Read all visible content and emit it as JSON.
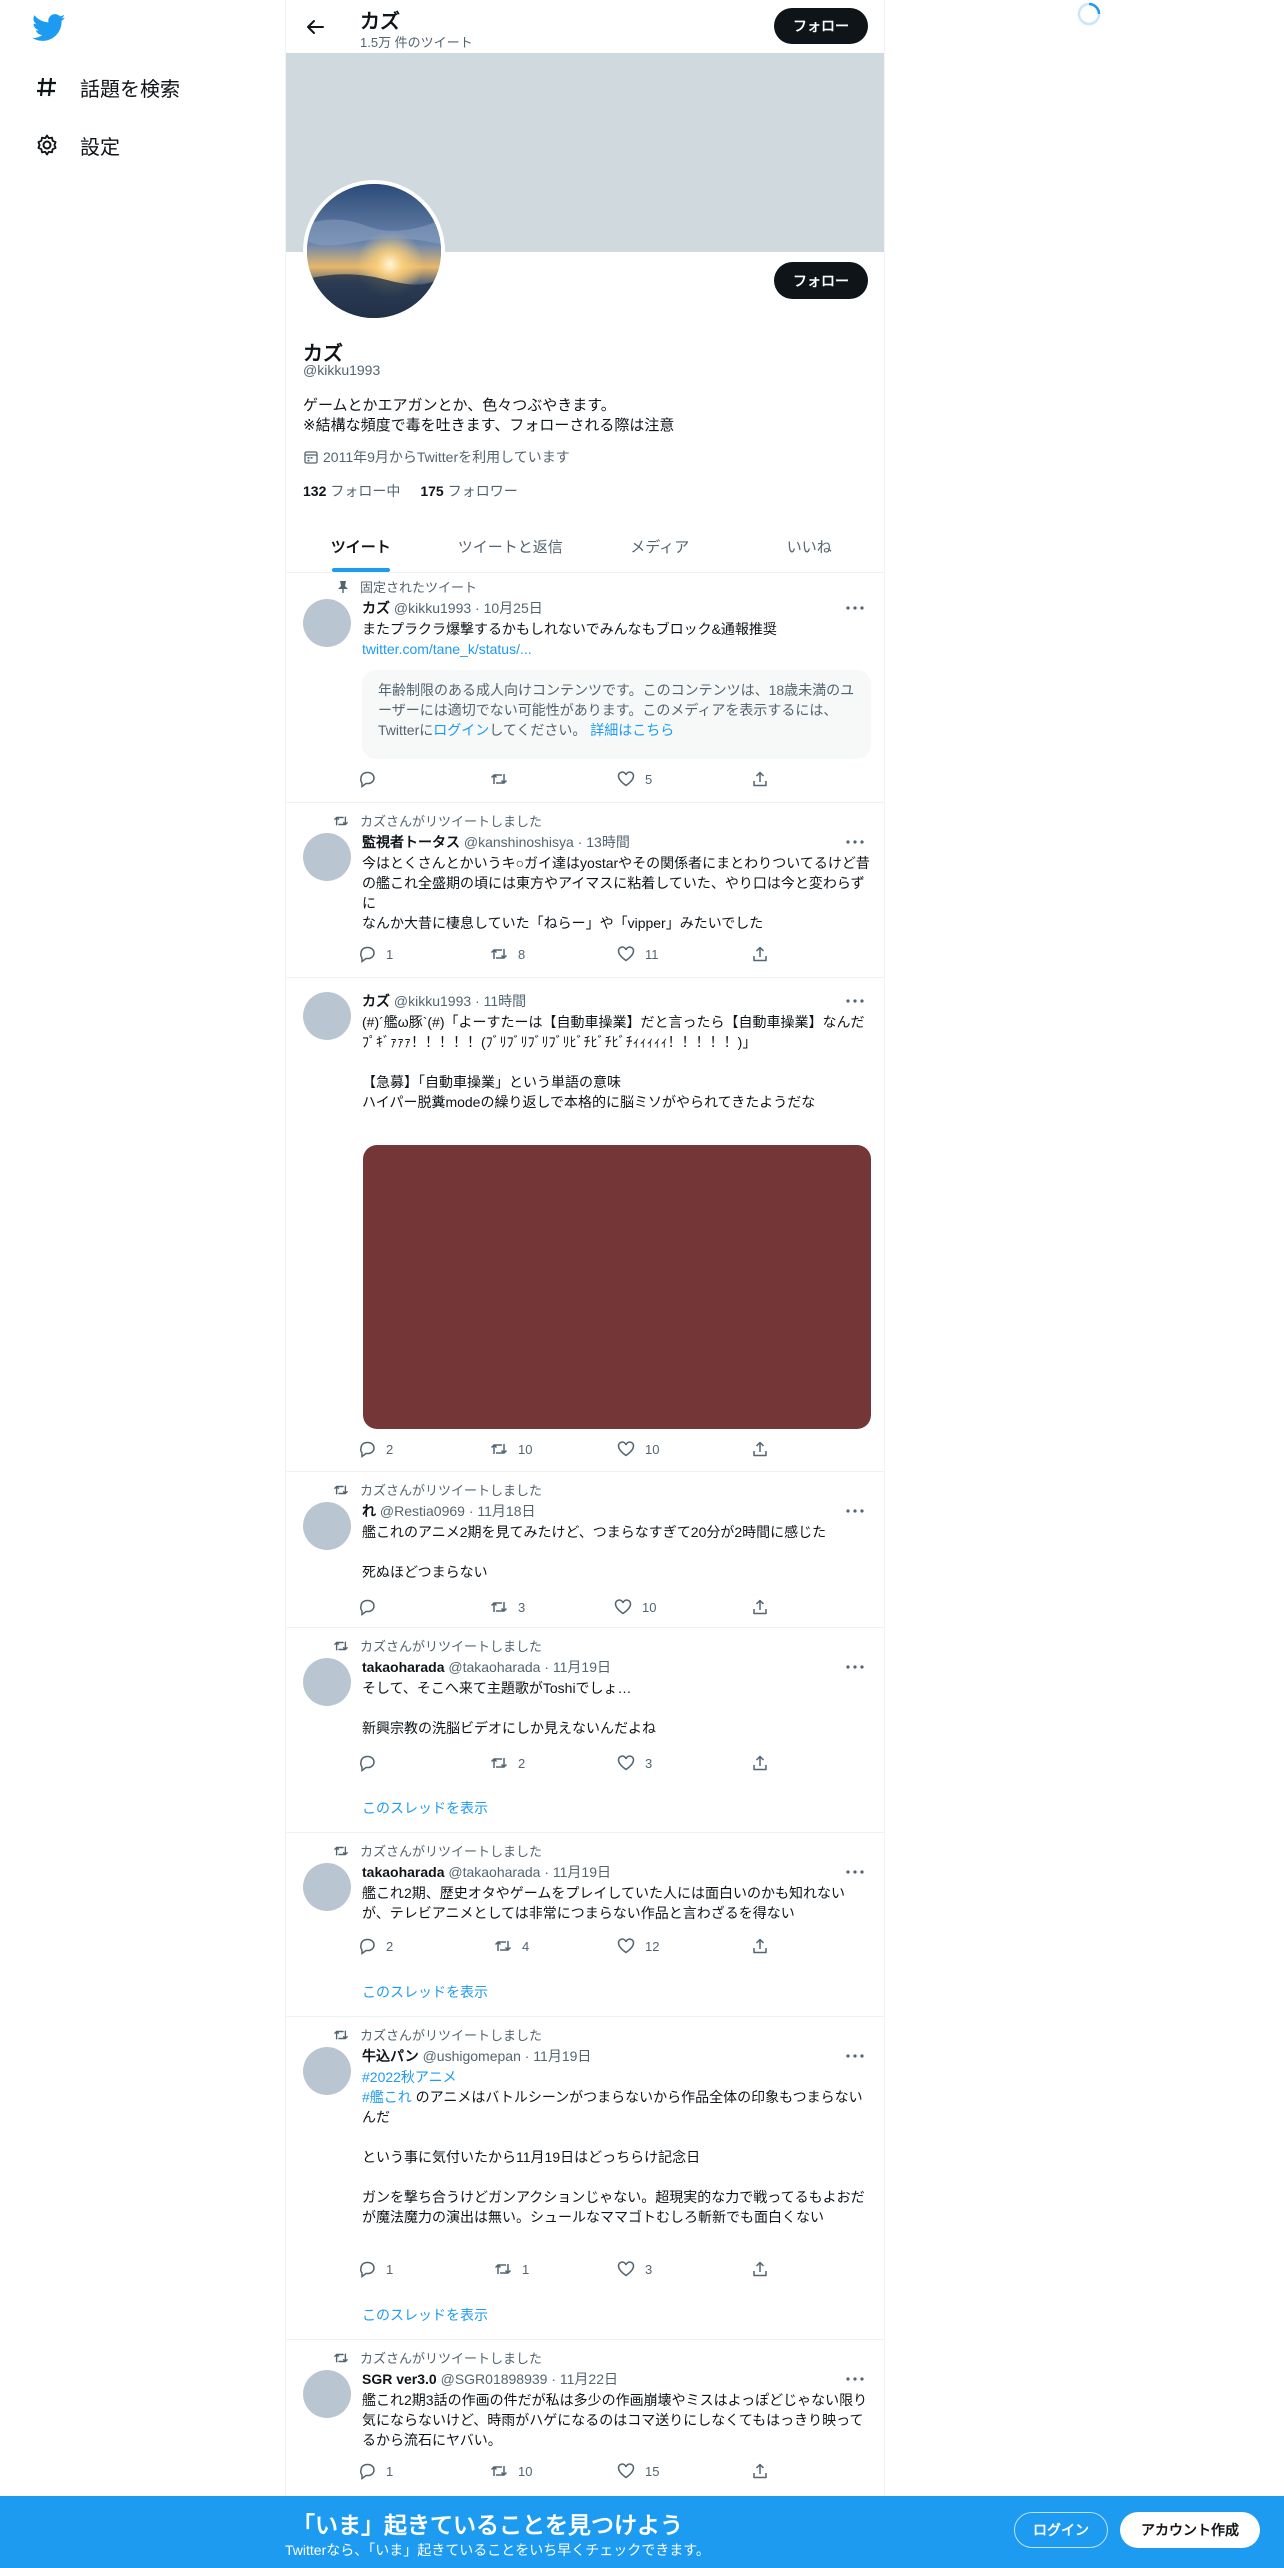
{
  "sidebar": {
    "logo": "twitter-bird-icon",
    "items": [
      {
        "label": "話題を検索",
        "icon": "hashtag-icon"
      },
      {
        "label": "設定",
        "icon": "gear-icon"
      }
    ]
  },
  "header": {
    "name": "カズ",
    "tweet_count": "1.5万 件のツイート",
    "follow_label": "フォロー"
  },
  "profile": {
    "name": "カズ",
    "handle": "@kikku1993",
    "bio": "ゲームとかエアガンとか、色々つぶやきます。\n※結構な頻度で毒を吐きます、フォローされる際は注意",
    "joined": "2011年9月からTwitterを利用しています",
    "following_count": "132",
    "following_label": "フォロー中",
    "followers_count": "175",
    "followers_label": "フォロワー",
    "follow_label": "フォロー"
  },
  "tabs": [
    "ツイート",
    "ツイートと返信",
    "メディア",
    "いいね"
  ],
  "tweets": [
    {
      "context": "固定されたツイート",
      "name": "カズ",
      "meta": "@kikku1993 · 10月25日",
      "body": "またプラクラ爆撃するかもしれないでみんなもブロック&通報推奨",
      "link": "twitter.com/tane_k/status/...",
      "sensitive_text": "年齢制限のある成人向けコンテンツです。このコンテンツは、18歳未満のユーザーには適切でない可能性があります。このメディアを表示するには、Twitterに",
      "sensitive_login": "ログイン",
      "sensitive_mid": "してください。",
      "sensitive_more": "詳細はこちら",
      "replies": "",
      "retweets": "",
      "likes": "5"
    },
    {
      "context": "カズさんがリツイートしました",
      "name": "監視者トータス",
      "meta": "@kanshinoshisya · 13時間",
      "body": "今はとくさんとかいうキ○ガイ達はyostarやその関係者にまとわりついてるけど昔の艦これ全盛期の頃には東方やアイマスに粘着していた、やり口は今と変わらずに\nなんか大昔に棲息していた「ねらー」や「vipper」みたいでした",
      "replies": "1",
      "retweets": "8",
      "likes": "11"
    },
    {
      "context": "",
      "name": "カズ",
      "meta": "@kikku1993 · 11時間",
      "body": "(#)´艦ω豚`(#)「よーすたーは【自動車操業】だと言ったら【自動車操業】なんだﾌﾟｷﾞｧｧｧ！！！！！(ﾌﾞﾘﾌﾞﾘﾌﾞﾘﾌﾞﾘﾋﾞﾁﾋﾞﾁﾋﾞﾁｨｨｨｨｨ！！！！！)」\n\n【急募】「自動車操業」という単語の意味\nハイパー脱糞modeの繰り返しで本格的に脳ミソがやられてきたようだな",
      "replies": "2",
      "retweets": "10",
      "likes": "10"
    },
    {
      "context": "カズさんがリツイートしました",
      "name": "れ",
      "meta": "@Restia0969 · 11月18日",
      "body": "艦これのアニメ2期を見てみたけど、つまらなすぎて20分が2時間に感じた\n\n死ぬほどつまらない",
      "replies": "",
      "retweets": "3",
      "likes": "10"
    },
    {
      "context": "カズさんがリツイートしました",
      "name": "takaoharada",
      "meta": "@takaoharada · 11月19日",
      "body": "そして、そこへ来て主題歌がToshiでしょ…\n\n新興宗教の洗脳ビデオにしか見えないんだよね",
      "replies": "",
      "retweets": "2",
      "likes": "3",
      "thread": "このスレッドを表示"
    },
    {
      "context": "カズさんがリツイートしました",
      "name": "takaoharada",
      "meta": "@takaoharada · 11月19日",
      "body": "艦これ2期、歴史オタやゲームをプレイしていた人には面白いのかも知れないが、テレビアニメとしては非常につまらない作品と言わざるを得ない",
      "replies": "2",
      "retweets": "4",
      "likes": "12",
      "thread": "このスレッドを表示"
    },
    {
      "context": "カズさんがリツイートしました",
      "name": "牛込パン",
      "meta": "@ushigomepan · 11月19日",
      "hashtag1": "#2022秋アニメ",
      "hashtag2": "#艦これ",
      "body": " のアニメはバトルシーンがつまらないから作品全体の印象もつまらないんだ\n\nという事に気付いたから11月19日はどっちらけ記念日\n\nガンを撃ち合うけどガンアクションじゃない。超現実的な力で戦ってるもよおだが魔法魔力の演出は無い。シュールなママゴトむしろ斬新でも面白くない",
      "replies": "1",
      "retweets": "1",
      "likes": "3",
      "thread": "このスレッドを表示"
    },
    {
      "context": "カズさんがリツイートしました",
      "name": "SGR ver3.0",
      "meta": "@SGR01898939 · 11月22日",
      "body": "艦これ2期3話の作画の件だが私は多少の作画崩壊やミスはよっぽどじゃない限り気にならないけど、時雨がハゲになるのはコマ送りにしなくてもはっきり映ってるから流石にヤバい。",
      "replies": "1",
      "retweets": "10",
      "likes": "15"
    }
  ],
  "bottom_bar": {
    "title": "「いま」起きていることを見つけよう",
    "subtitle": "Twitterなら、「いま」起きていることをいち早くチェックできます。",
    "login": "ログイン",
    "signup": "アカウント作成"
  },
  "colors": {
    "accent": "#1d9bf0",
    "text": "#0f1419",
    "muted": "#536471",
    "banner": "#cfd9de",
    "media": "#753638"
  }
}
